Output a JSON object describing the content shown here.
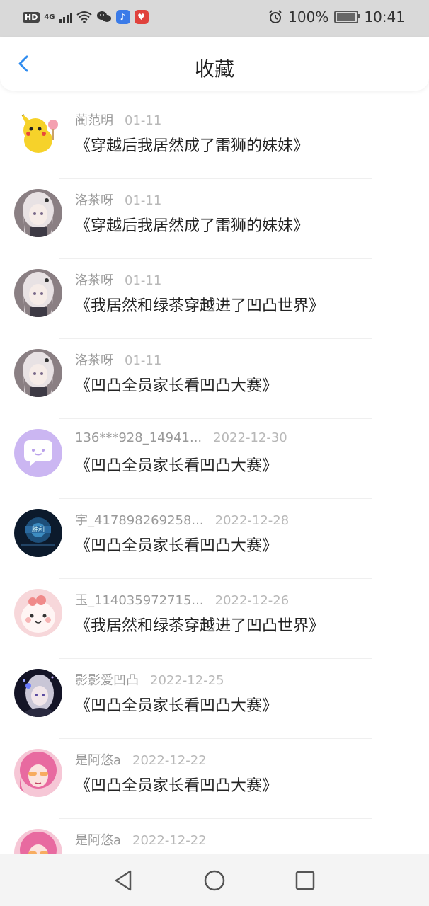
{
  "status_bar": {
    "hd": "HD",
    "signal": "4G",
    "battery": "100%",
    "time": "10:41"
  },
  "header": {
    "title": "收藏"
  },
  "items": [
    {
      "name": "蔺范明",
      "date": "01-11",
      "book": "《穿越后我居然成了雷狮的妹妹》",
      "avatar": "pikachu"
    },
    {
      "name": "洛茶呀",
      "date": "01-11",
      "book": "《穿越后我居然成了雷狮的妹妹》",
      "avatar": "anime-girl-white"
    },
    {
      "name": "洛茶呀",
      "date": "01-11",
      "book": "《我居然和绿茶穿越进了凹凸世界》",
      "avatar": "anime-girl-white"
    },
    {
      "name": "洛茶呀",
      "date": "01-11",
      "book": "《凹凸全员家长看凹凸大赛》",
      "avatar": "anime-girl-white"
    },
    {
      "name": "136***928_14941...",
      "date": "2022-12-30",
      "book": "《凹凸全员家长看凹凸大赛》",
      "avatar": "chat-bubble"
    },
    {
      "name": "宇_417898269258...",
      "date": "2022-12-28",
      "book": "《凹凸全员家长看凹凸大赛》",
      "avatar": "victory-game"
    },
    {
      "name": "玉_114035972715...",
      "date": "2022-12-26",
      "book": "《我居然和绿茶穿越进了凹凸世界》",
      "avatar": "pink-blob"
    },
    {
      "name": "影影爱凹凸",
      "date": "2022-12-25",
      "book": "《凹凸全员家长看凹凸大赛》",
      "avatar": "anime-girl-dark"
    },
    {
      "name": "是阿悠a",
      "date": "2022-12-22",
      "book": "《凹凸全员家长看凹凸大赛》",
      "avatar": "anime-girl-pink"
    },
    {
      "name": "是阿悠a",
      "date": "2022-12-22",
      "book": "",
      "avatar": "anime-girl-pink"
    }
  ],
  "colors": {
    "accent": "#2f8cf0",
    "status_bg": "#d9d9d9",
    "name": "#999999",
    "date": "#b8b8b8"
  }
}
